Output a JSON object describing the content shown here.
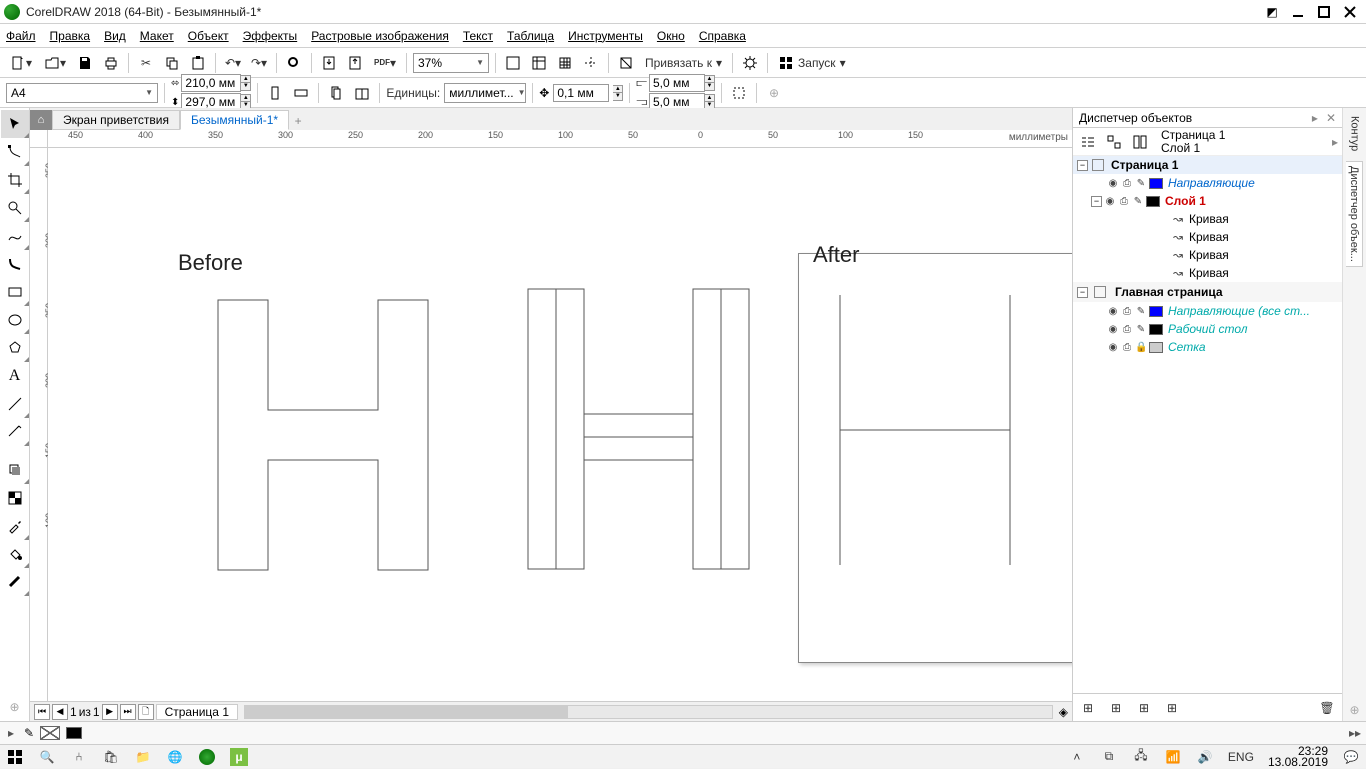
{
  "title": "CorelDRAW 2018 (64-Bit) - Безымянный-1*",
  "menu": [
    "Файл",
    "Правка",
    "Вид",
    "Макет",
    "Объект",
    "Эффекты",
    "Растровые изображения",
    "Текст",
    "Таблица",
    "Инструменты",
    "Окно",
    "Справка"
  ],
  "toolbar": {
    "zoom": "37%",
    "snap": "Привязать к",
    "launch": "Запуск"
  },
  "property": {
    "pagesize": "A4",
    "width": "210,0 мм",
    "height": "297,0 мм",
    "units_label": "Единицы:",
    "units": "миллимет...",
    "nudge": "0,1 мм",
    "dupx": "5,0 мм",
    "dupy": "5,0 мм"
  },
  "tabs": {
    "welcome": "Экран приветствия",
    "doc": "Безымянный-1*"
  },
  "ruler_unit": "миллиметры",
  "ruler_h": [
    "450",
    "400",
    "350",
    "300",
    "250",
    "200",
    "150",
    "100",
    "50",
    "0",
    "50",
    "100",
    "150"
  ],
  "ruler_v": [
    "350",
    "300",
    "250",
    "200",
    "150",
    "100"
  ],
  "canvas": {
    "before": "Before",
    "after": "After"
  },
  "pagenav": {
    "page": "1",
    "of": "из",
    "total": "1",
    "tab": "Страница 1"
  },
  "objmgr": {
    "title": "Диспетчер объектов",
    "page": "Страница 1",
    "layer": "Слой 1",
    "tree": {
      "page1": "Страница 1",
      "guides": "Направляющие",
      "layer1": "Слой 1",
      "curve": "Кривая",
      "master": "Главная страница",
      "mguides": "Направляющие (все ст...",
      "desktop": "Рабочий стол",
      "grid": "Сетка"
    }
  },
  "docktabs": [
    "Контур",
    "Диспетчер объек..."
  ],
  "colors": [
    "#000000",
    "#222222",
    "#ffffff",
    "#00a0e3",
    "#e6007e",
    "#ffed00",
    "#009640",
    "#e30613",
    "#312783",
    "#f39200",
    "#95c11f",
    "#ef7d00",
    "#a3195b",
    "#006f3d",
    "#951b81"
  ],
  "status": {
    "lang": "ENG",
    "time": "23:29",
    "date": "13.08.2019"
  }
}
